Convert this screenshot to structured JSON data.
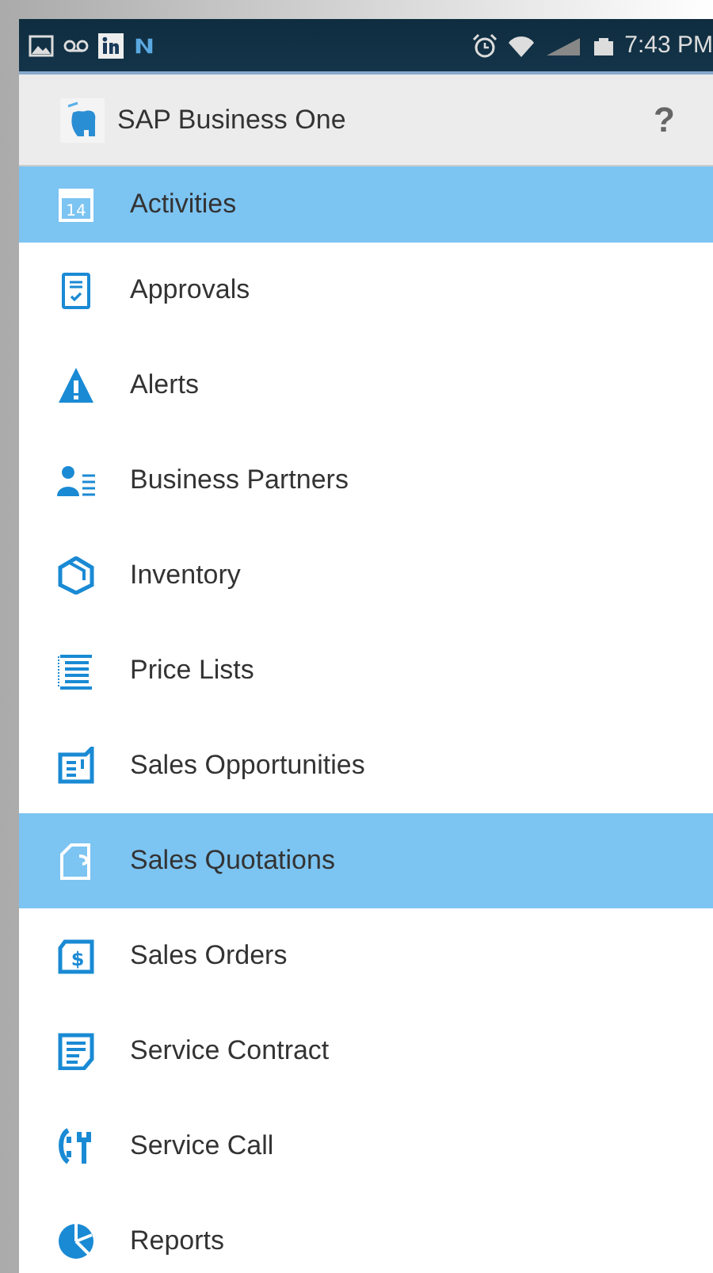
{
  "status_bar": {
    "time": "7:43 PM"
  },
  "header": {
    "title": "SAP Business One",
    "help": "?"
  },
  "menu": [
    {
      "label": "Activities",
      "kind": "calendar",
      "selected": true,
      "icon_text": "14"
    },
    {
      "label": "Approvals",
      "kind": "approval",
      "selected": false
    },
    {
      "label": "Alerts",
      "kind": "alert",
      "selected": false
    },
    {
      "label": "Business Partners",
      "kind": "partners",
      "selected": false
    },
    {
      "label": "Inventory",
      "kind": "inventory",
      "selected": false
    },
    {
      "label": "Price Lists",
      "kind": "pricelist",
      "selected": false
    },
    {
      "label": "Sales Opportunities",
      "kind": "opportunity",
      "selected": false
    },
    {
      "label": "Sales Quotations",
      "kind": "quotation",
      "selected": true
    },
    {
      "label": "Sales Orders",
      "kind": "order",
      "selected": false,
      "icon_text": "$"
    },
    {
      "label": "Service Contract",
      "kind": "contract",
      "selected": false
    },
    {
      "label": "Service Call",
      "kind": "call",
      "selected": false
    },
    {
      "label": "Reports",
      "kind": "reports",
      "selected": false
    }
  ]
}
